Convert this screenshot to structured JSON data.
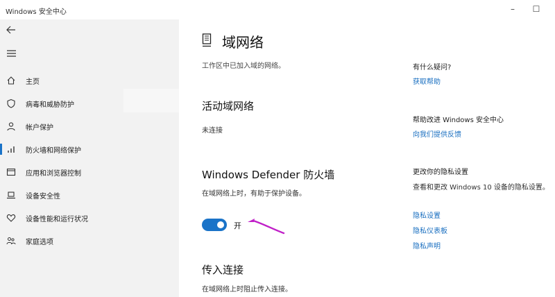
{
  "window": {
    "title": "Windows 安全中心",
    "minimize_glyph": "–",
    "maximize_glyph": "☐"
  },
  "sidebar": {
    "back_icon": "back-arrow-icon",
    "menu_icon": "hamburger-menu-icon",
    "items": [
      {
        "label": "主页",
        "icon": "home-icon"
      },
      {
        "label": "病毒和威胁防护",
        "icon": "shield-icon"
      },
      {
        "label": "帐户保护",
        "icon": "person-icon"
      },
      {
        "label": "防火墙和网络保护",
        "icon": "wifi-signal-icon",
        "active": true
      },
      {
        "label": "应用和浏览器控制",
        "icon": "app-window-icon"
      },
      {
        "label": "设备安全性",
        "icon": "laptop-icon"
      },
      {
        "label": "设备性能和运行状况",
        "icon": "heart-icon"
      },
      {
        "label": "家庭选项",
        "icon": "family-icon"
      }
    ]
  },
  "main": {
    "page_icon": "domain-network-icon",
    "title": "域网络",
    "description": "工作区中已加入域的网络。",
    "active_section": {
      "heading": "活动域网络",
      "status": "未连接"
    },
    "firewall": {
      "heading": "Windows Defender 防火墙",
      "description": "在域网络上时，有助于保护设备。",
      "toggle_on": true,
      "toggle_label": "开"
    },
    "incoming": {
      "heading": "传入连接",
      "description": "在域网络上时阻止传入连接。"
    }
  },
  "right_panel": {
    "help_heading": "有什么疑问?",
    "help_link": "获取帮助",
    "improve_heading": "帮助改进 Windows 安全中心",
    "improve_link": "向我们提供反馈",
    "privacy_heading": "更改你的隐私设置",
    "privacy_text": "查看和更改 Windows 10 设备的隐私设置。",
    "privacy_links": [
      "隐私设置",
      "隐私仪表板",
      "隐私声明"
    ]
  },
  "colors": {
    "accent": "#1a73c8",
    "link": "#1a6fc0",
    "annotation_arrow": "#c020c8"
  }
}
